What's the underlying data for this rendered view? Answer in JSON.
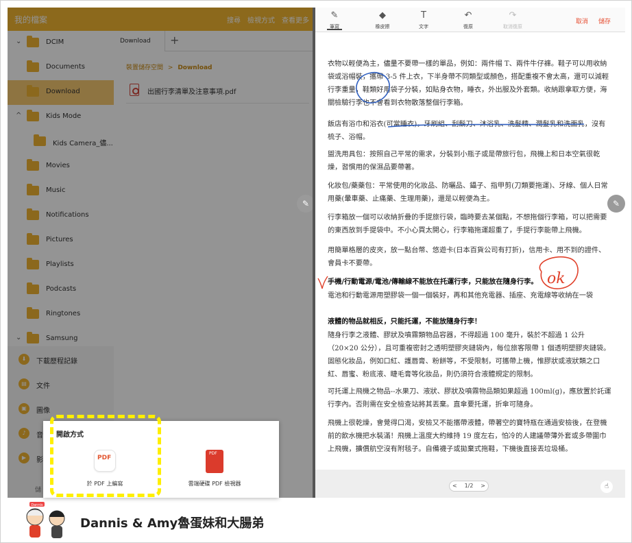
{
  "file_manager": {
    "title": "我的檔案",
    "actions": [
      "搜尋",
      "檢視方式",
      "查看更多"
    ],
    "tree": [
      {
        "label": "DCIM",
        "chevron": "⌄"
      },
      {
        "label": "Documents",
        "chevron": ""
      },
      {
        "label": "Download",
        "chevron": "",
        "selected": true
      },
      {
        "label": "Kids Mode",
        "chevron": "^"
      },
      {
        "label": "Kids Camera_儘...",
        "chevron": ""
      },
      {
        "label": "Movies",
        "chevron": ""
      },
      {
        "label": "Music",
        "chevron": ""
      },
      {
        "label": "Notifications",
        "chevron": ""
      },
      {
        "label": "Pictures",
        "chevron": ""
      },
      {
        "label": "Playlists",
        "chevron": ""
      },
      {
        "label": "Podcasts",
        "chevron": ""
      },
      {
        "label": "Ringtones",
        "chevron": ""
      },
      {
        "label": "Samsung",
        "chevron": "⌄"
      }
    ],
    "categories": [
      "下載歷程記錄",
      "文件",
      "圖像",
      "音",
      "影"
    ],
    "tab_label": "Download",
    "tab_add": "+",
    "breadcrumb_root": "裝置儲存空間",
    "breadcrumb_sep": ">",
    "breadcrumb_current": "Download",
    "file_name": "出國行李清單及注意事項.pdf",
    "storage_label": "儲"
  },
  "open_with": {
    "title": "開啟方式",
    "apps": [
      {
        "label": "於 PDF 上編寫",
        "icon_text": "PDF"
      },
      {
        "label": "雲端硬碟 PDF 檢視器",
        "icon_text": "PDF"
      }
    ]
  },
  "editor": {
    "tools": [
      {
        "label": "筆寫",
        "icon": "pen-icon",
        "glyph": "✎"
      },
      {
        "label": "橡皮擦",
        "icon": "eraser-icon",
        "glyph": "◆"
      },
      {
        "label": "文字",
        "icon": "text-icon",
        "glyph": "T"
      },
      {
        "label": "復原",
        "icon": "undo-icon",
        "glyph": "↶"
      },
      {
        "label": "取消復原",
        "icon": "redo-icon",
        "glyph": "↷"
      }
    ],
    "cancel": "取消",
    "save": "儲存",
    "paragraphs": [
      "衣物以輕便為主，儘量不要帶一樣的單品，例如：兩件帽 T、兩件牛仔褲。鞋子可以用收納袋或浴帽裝，攜帶 3-5 件上衣，下半身帶不同類型或顏色，搭配重複不會太高，還可以減輕行李重量，鞋類好用袋子分裝，如貼身衣物，睡衣，外出服及外套類。收納跟拿取方便，海關檢驗行李也不會看到衣物散落整個行李箱。",
      "飯店有浴巾和浴衣(可當睡衣)，牙刷組、刮鬍刀、沐浴乳、洗髮精、潤髮乳和洗面乳，沒有梳子、浴帽。",
      "盥洗用具包：按照自己平常的需求，分裝到小瓶子或是帶旅行包，飛機上和日本空氣很乾燥，習慣用的保濕品要帶著。",
      "化妝包/藥藥包：平常使用的化妝品、防曬品、鑷子、指甲剪(刀類要拖運)、牙線、個人日常用藥(暈車藥、止痛藥、生理用藥)，還是以輕便為主。",
      "行李箱放一個可以收納折疊的手提旅行袋，臨時要去某個點，不想拖個行李箱，可以把需要的東西放到手提袋中。不小心買太開心，行李箱拖運超重了，手提行李能帶上飛機。",
      "用簡單格層的皮夾，放一點台幣、悠遊卡(日本百貨公司有打折)，信用卡、用不到的證件、會員卡不要帶。",
      "手機/行動電源/電池/傳輸線不能放在托運行李，只能放在隨身行李。",
      "電池和行動電源用塑膠袋一個一個裝好，再和其他充電器、插座、充電線等收納在一袋",
      "液體的物品就相反，只能托運，不能放隨身行李！",
      "隨身行李之液體、膠狀及噴霧類物品容器，不得超過 100 毫升，裝於不超過 1 公升（20×20 公分），且可重複密封之透明塑膠夾鏈袋內，每位旅客限帶 1 個透明塑膠夾鏈袋。",
      "固態化妝品，例如口紅、護唇膏、粉餅等，不受限制，可攜帶上機，惟膠狀或液狀類之口紅、唇蜜、粉底液、睫毛膏等化妝品，則仍須符合液體規定的限制。",
      "可托運上飛機之物品--水果刀、液狀、膠狀及噴霧物品類如果超過 100ml(g)，應放置於託運行李內。否則需在安全檢查站將其丟棄。直傘要托運，折傘可隨身。",
      "飛機上很乾燥，會覺得口渴，安檢又不能攜帶液體，帶著空的寶特瓶在通過安檢後，在登機前的飲水機把水裝滿！飛機上溫度大約維持 19 度左右，怕冷的人建議帶薄外套或多帶圍巾上飛機，擴償航空沒有附毯子。自備襪子或拋棄式拖鞋，下機後直接丟垃圾桶。"
    ],
    "bold_paragraphs": [
      6,
      8
    ],
    "bold_leads": {
      "1": "飯店",
      "12": "飛機"
    },
    "annotation_text": "ok",
    "page_indicator": "1/2",
    "prev": "<",
    "next": ">"
  },
  "branding": {
    "text": "Dannis & Amy魯蛋妹和大腸弟",
    "mascot_caption": "Dannis"
  },
  "colors": {
    "accent": "#f1b531",
    "ink_blue": "#2f5fbf",
    "ink_red": "#e0402a",
    "highlight_dash": "#ffef00",
    "action_red": "#e65135"
  }
}
